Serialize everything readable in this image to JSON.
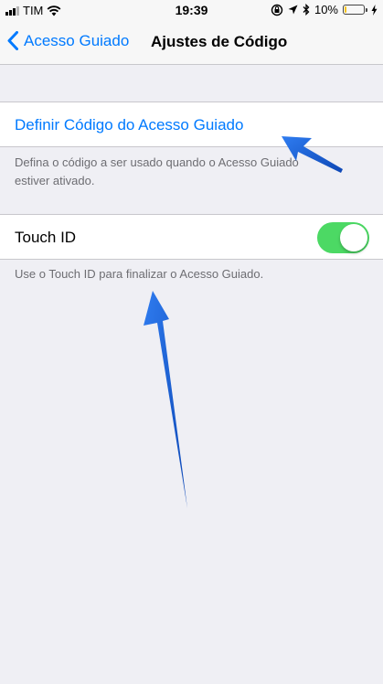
{
  "status_bar": {
    "carrier": "TIM",
    "time": "19:39",
    "battery_percent": "10%",
    "battery_level": 0.1,
    "icons": [
      "signal-icon",
      "wifi-icon",
      "orientation-lock-icon",
      "location-icon",
      "bluetooth-icon",
      "battery-icon",
      "charging-icon"
    ]
  },
  "nav": {
    "back_label": "Acesso Guiado",
    "title": "Ajustes de Código"
  },
  "sections": {
    "passcode": {
      "label": "Definir Código do Acesso Guiado",
      "footer_line1": "Defina o código a ser usado quando o Acesso Guiado",
      "footer_line2": "estiver ativado."
    },
    "touch_id": {
      "label": "Touch ID",
      "enabled": true,
      "footer": "Use o Touch ID para finalizar o Acesso Guiado."
    }
  },
  "colors": {
    "accent": "#007aff",
    "toggle_on": "#4cd964",
    "annotation_arrow": "#1a5fcf",
    "background": "#efeff4"
  }
}
